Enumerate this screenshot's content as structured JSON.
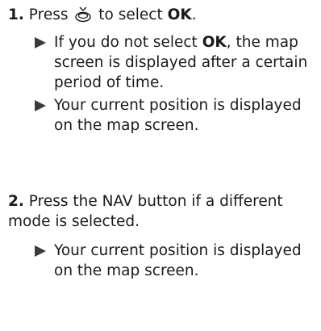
{
  "step1": {
    "number": "1.",
    "press": "Press",
    "dial_icon": "interface-dial-press-icon",
    "to_select": "to select",
    "ok": "OK",
    "period": ".",
    "results": [
      {
        "pre": "If you do not select ",
        "ok": "OK",
        "post": ", the map screen is displayed after a certain period of time."
      },
      {
        "text": "Your current position is displayed on the map screen."
      }
    ]
  },
  "step2": {
    "number": "2.",
    "text": "Press the NAV button if a different mode is selected.",
    "results": [
      {
        "text": "Your current position is displayed on the map screen."
      }
    ]
  },
  "arrow_color": "#3a3a3a"
}
